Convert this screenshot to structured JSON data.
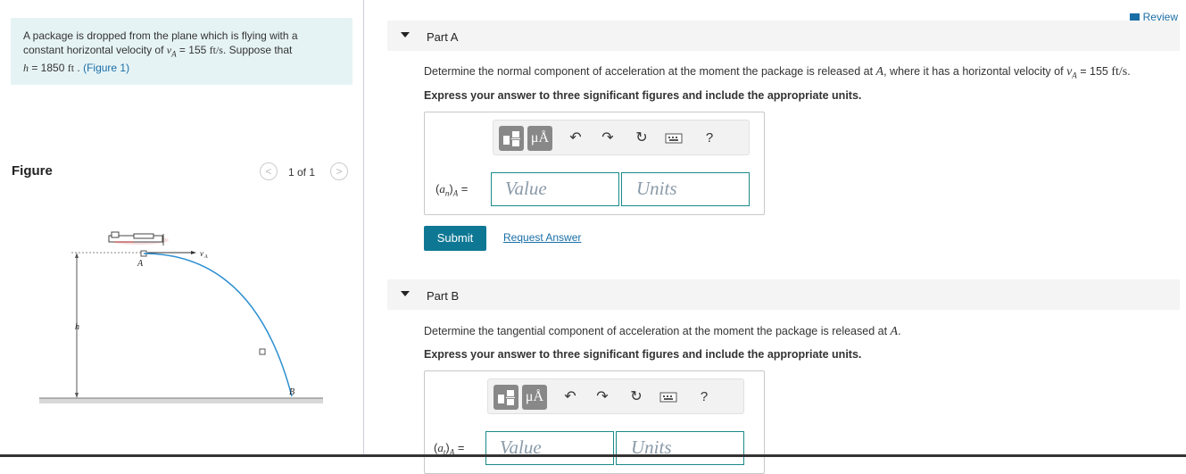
{
  "problem": {
    "text_before_v": "A package is dropped from the plane which is flying with a constant horizontal velocity of ",
    "v_symbol": "v",
    "v_sub": "A",
    "v_eq": " = 155 ",
    "v_unit": "ft/s",
    "text_mid": ". Suppose that ",
    "h_symbol": "h",
    "h_eq": " = 1850 ",
    "h_unit": "ft",
    "figure_link": "(Figure 1)"
  },
  "figure": {
    "label": "Figure",
    "pager_prev": "<",
    "pager_next": ">",
    "pager_count": "1 of 1",
    "labels": {
      "A": "A",
      "vA_v": "v",
      "vA_sub": "A",
      "h": "h",
      "B": "B"
    }
  },
  "review": {
    "label": "Review"
  },
  "parts": [
    {
      "title": "Part A",
      "question_before": "Determine the normal component of acceleration at the moment the package is released at ",
      "question_point": "A",
      "question_after": ", where it has a horizontal velocity of ",
      "question_v": "v",
      "question_v_sub": "A",
      "question_value": " = 155 ",
      "question_unit": "ft/s",
      "question_end": ".",
      "instruction": "Express your answer to three significant figures and include the appropriate units.",
      "eq_var": "a",
      "eq_var_sub": "n",
      "eq_sub": "A",
      "value_placeholder": "Value",
      "units_placeholder": "Units"
    },
    {
      "title": "Part B",
      "question_before": "Determine the tangential component of acceleration at the moment the package is released at ",
      "question_point": "A",
      "question_end": ".",
      "instruction": "Express your answer to three significant figures and include the appropriate units.",
      "eq_var": "a",
      "eq_var_sub": "t",
      "eq_sub": "A",
      "value_placeholder": "Value",
      "units_placeholder": "Units"
    }
  ],
  "toolbar": {
    "unit_label": "μÅ",
    "undo_icon": "undo-icon",
    "redo_icon": "redo-icon",
    "reset_icon": "reset-icon",
    "keyboard_icon": "keyboard-icon",
    "help_label": "?"
  },
  "actions": {
    "submit_label": "Submit",
    "request_label": "Request Answer"
  }
}
